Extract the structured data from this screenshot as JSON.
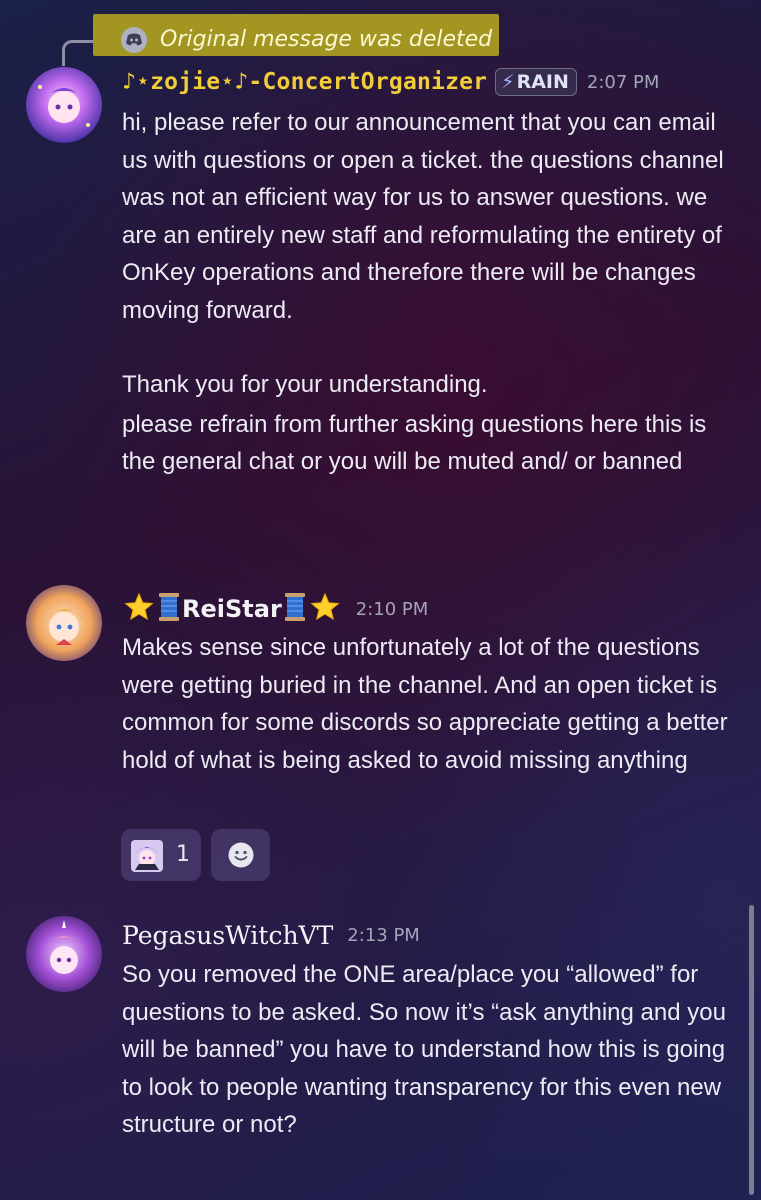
{
  "reply": {
    "text": "Original message was deleted",
    "icon": "discord-icon"
  },
  "messages": [
    {
      "username": "♪⋆zojie⋆♪-ConcertOrganizer",
      "tag": "RAIN",
      "tag_icon": "lightning-icon",
      "time": "2:07 PM",
      "paragraphs": [
        "hi, please refer to our announcement that you can email us with questions or open a ticket. the questions channel was not an efficient way for us to answer questions. we are an entirely new staff and reformulating the entirety of OnKey operations and therefore there will be changes moving forward.",
        "Thank you for your understanding.",
        "please refrain from further asking questions here this is the general chat or you will be muted and/ or banned"
      ]
    },
    {
      "username": "ReiStar",
      "name_emoji": [
        "star-icon",
        "spool-icon"
      ],
      "time": "2:10 PM",
      "paragraphs": [
        "Makes sense since unfortunately a lot of the questions were getting buried in the channel. And an open ticket is common for some discords so appreciate getting a better hold of what is being asked to avoid missing anything"
      ],
      "reaction": {
        "count": "1",
        "icon": "custom-emoji-icon"
      },
      "add_reaction_icon": "smiley-icon"
    },
    {
      "username": "PegasusWitchVT",
      "time": "2:13 PM",
      "paragraphs": [
        "So you removed the ONE area/place you “allowed” for questions to be asked. So now it’s “ask anything and you will be banned” you have to understand how this is going to look to people wanting transparency for this even new structure or not?"
      ]
    }
  ],
  "colors": {
    "highlight": "#a39521",
    "zojie_name": "#f2cd3a",
    "text": "#ecebf3",
    "timestamp": "#a2a5b8"
  }
}
